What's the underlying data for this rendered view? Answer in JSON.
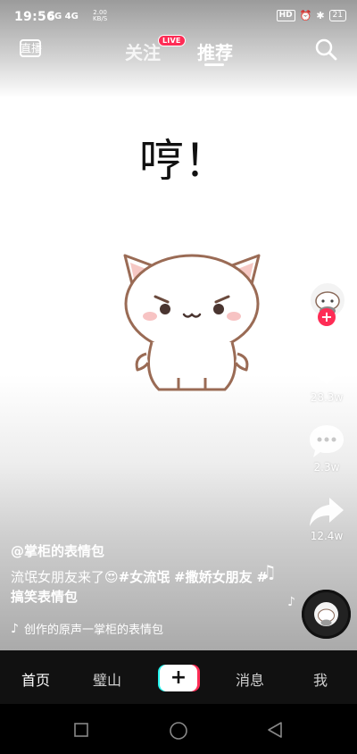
{
  "status_bar": {
    "time": "19:56",
    "net_left": "5G 4G",
    "speed_value": "2.00",
    "speed_unit": "KB/S",
    "hd_label": "HD",
    "battery": "21"
  },
  "top_nav": {
    "live_label": "直播",
    "follow_tab": "关注",
    "live_badge": "LIVE",
    "recommend_tab": "推荐"
  },
  "video": {
    "sticker_text": "哼！"
  },
  "right_rail": {
    "like_count": "28.3w",
    "comment_count": "2.3w",
    "share_count": "12.4w"
  },
  "info": {
    "author": "@掌柜的表情包",
    "desc_text": "流氓女朋友来了😍",
    "tag1": "#女流氓",
    "tag2": "#撒娇女朋友",
    "tag3": "#搞笑表情包",
    "music": "创作的原声一掌柜的表情包"
  },
  "bottom_nav": {
    "home": "首页",
    "second": "璧山",
    "plus": "+",
    "messages": "消息",
    "me": "我"
  },
  "colors": {
    "accent_red": "#fe2c55",
    "accent_cyan": "#25f4ee",
    "nav_bg": "#111111"
  },
  "icons": [
    "search-icon",
    "heart-icon",
    "comment-icon",
    "share-icon",
    "music-note-icon",
    "music-disc-icon",
    "square-nav-icon",
    "circle-nav-icon",
    "back-triangle-icon"
  ]
}
